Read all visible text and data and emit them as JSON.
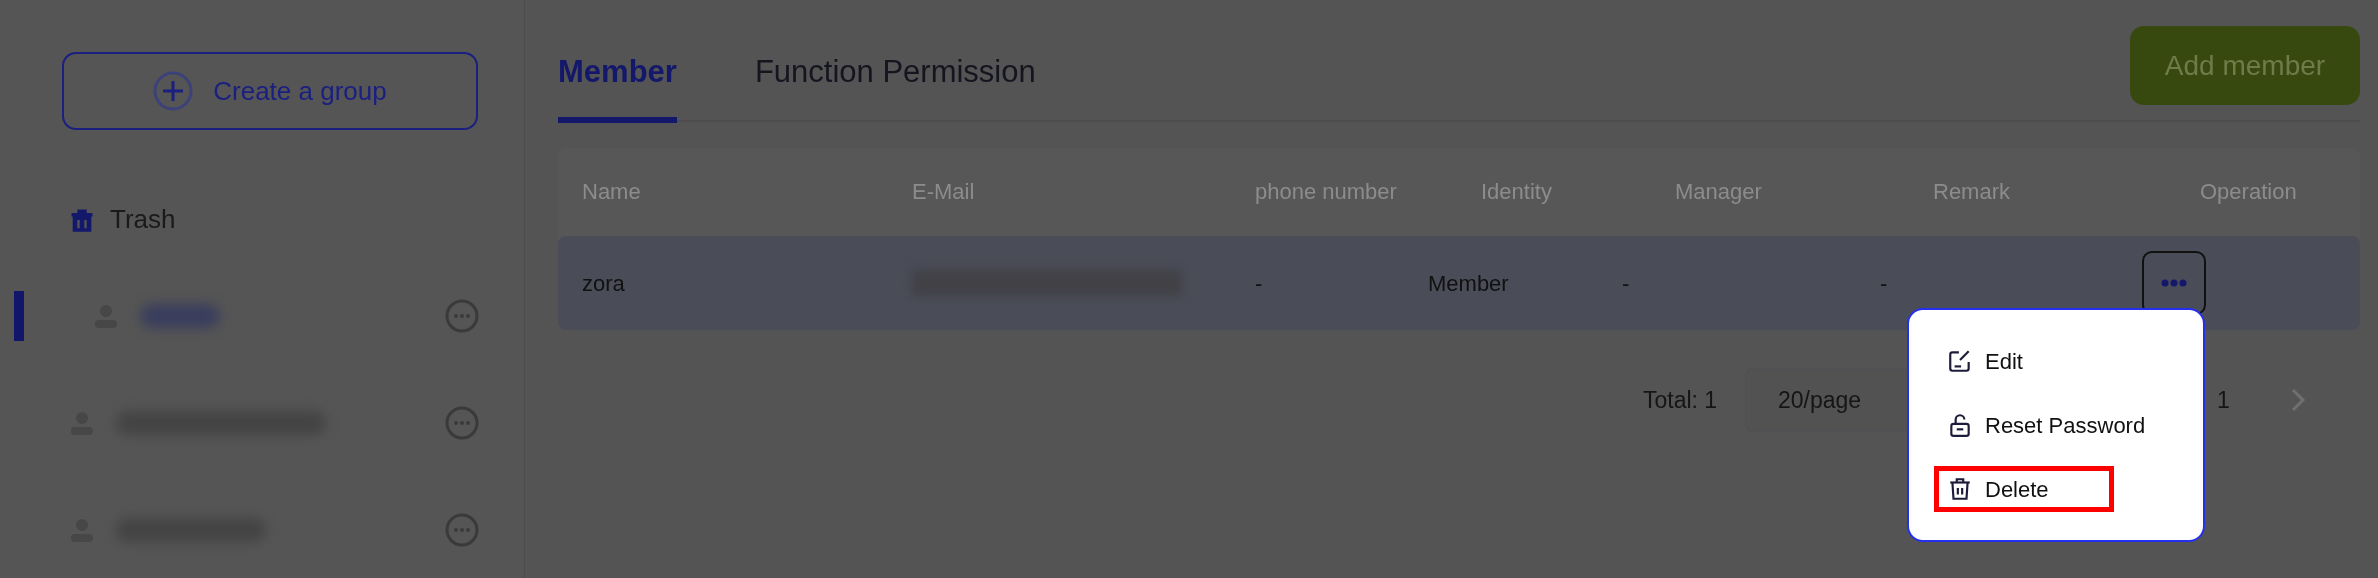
{
  "sidebar": {
    "create_button": "Create a group",
    "trash": "Trash",
    "groups": [
      {
        "selected": true
      },
      {
        "selected": false
      },
      {
        "selected": false
      }
    ]
  },
  "tabs": [
    {
      "label": "Member",
      "selected": true
    },
    {
      "label": "Function Permission",
      "selected": false
    }
  ],
  "add_button": "Add member",
  "table": {
    "columns": [
      "Name",
      "E-Mail",
      "phone number",
      "Identity",
      "Manager",
      "Remark",
      "Operation"
    ],
    "rows": [
      {
        "name": "zora",
        "phone": "-",
        "identity": "Member",
        "manager": "-",
        "remark": "-"
      }
    ]
  },
  "pagination": {
    "total": "Total: 1",
    "page_size": "20/page",
    "page": "1"
  },
  "menu": [
    {
      "kind": "edit",
      "label": "Edit",
      "highlighted": false
    },
    {
      "kind": "lock",
      "label": "Reset Password",
      "highlighted": false
    },
    {
      "kind": "trash",
      "label": "Delete",
      "highlighted": true
    }
  ]
}
